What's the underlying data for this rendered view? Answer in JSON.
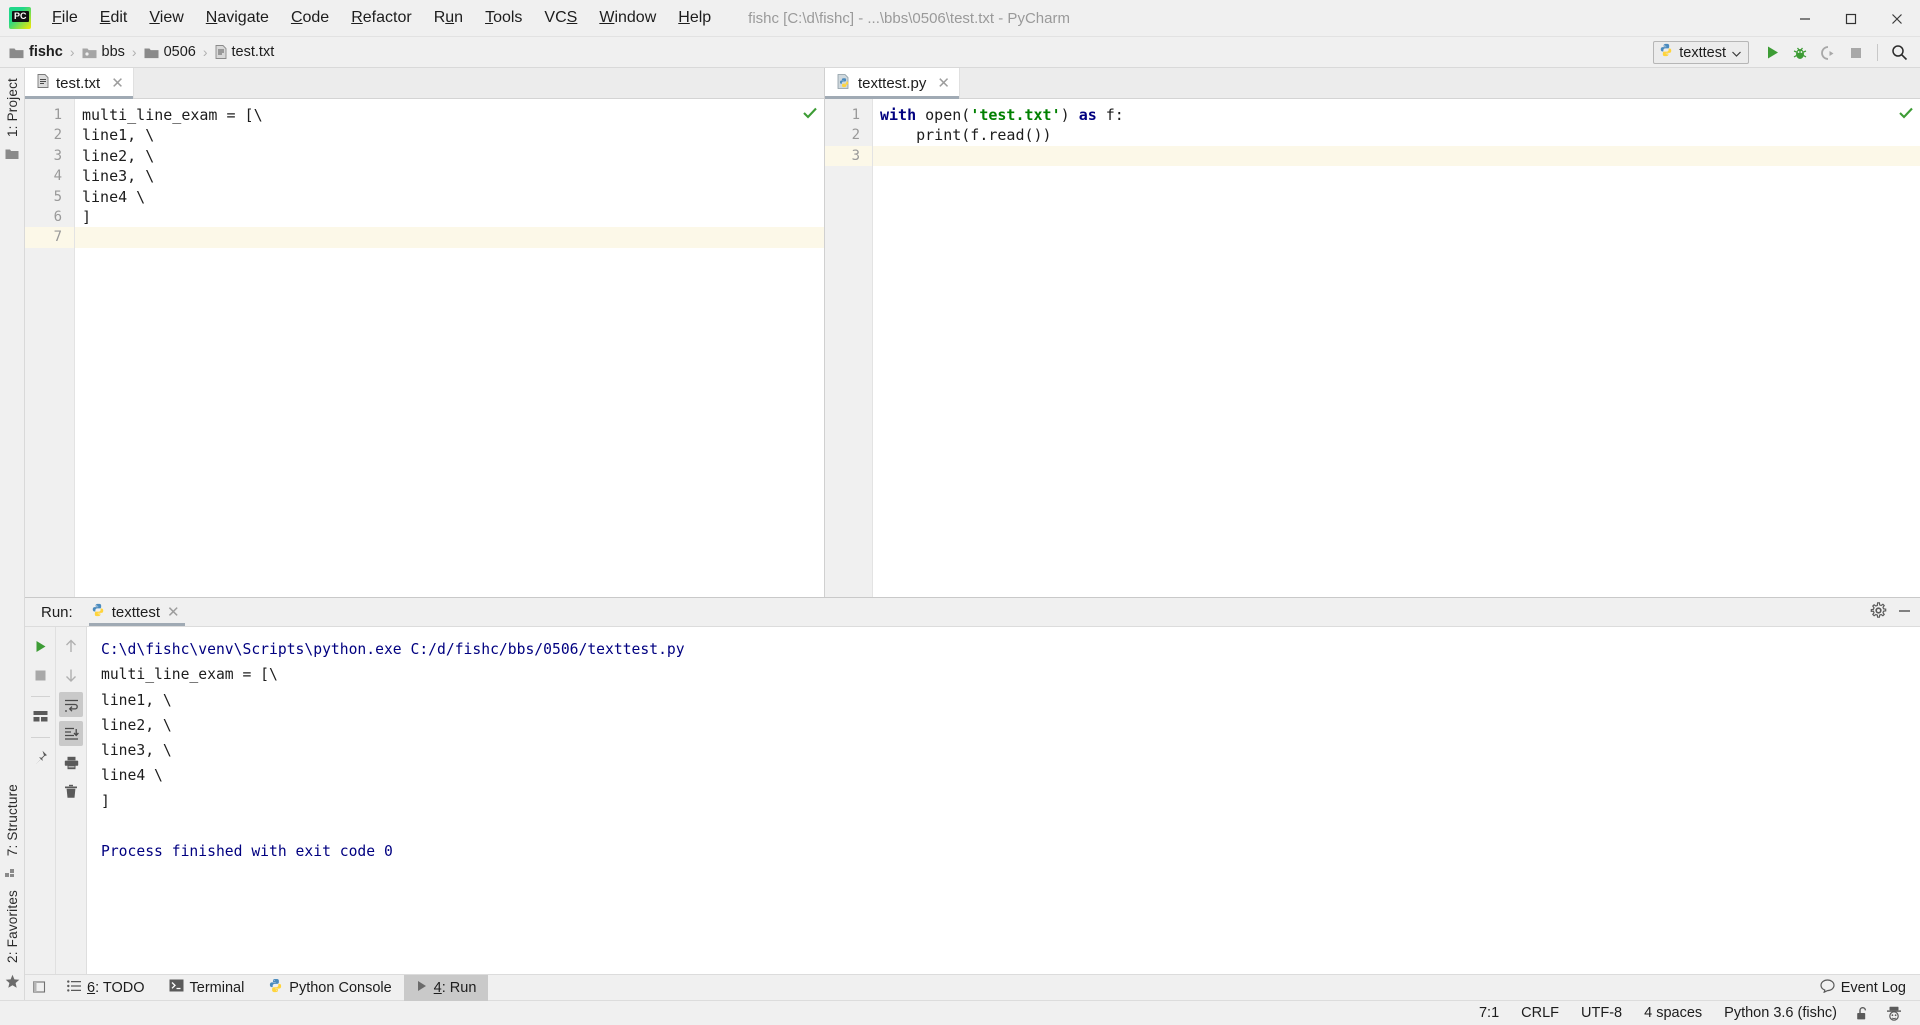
{
  "window": {
    "title": "fishc [C:\\d\\fishc] - ...\\bbs\\0506\\test.txt - PyCharm",
    "minimize": "─",
    "maximize": "❐",
    "close": "✕"
  },
  "menubar": {
    "items": [
      {
        "label": "File",
        "mnemonic": "F"
      },
      {
        "label": "Edit",
        "mnemonic": "E"
      },
      {
        "label": "View",
        "mnemonic": "V"
      },
      {
        "label": "Navigate",
        "mnemonic": "N"
      },
      {
        "label": "Code",
        "mnemonic": "C"
      },
      {
        "label": "Refactor",
        "mnemonic": "R"
      },
      {
        "label": "Run",
        "mnemonic": "u"
      },
      {
        "label": "Tools",
        "mnemonic": "T"
      },
      {
        "label": "VCS",
        "mnemonic": "S"
      },
      {
        "label": "Window",
        "mnemonic": "W"
      },
      {
        "label": "Help",
        "mnemonic": "H"
      }
    ]
  },
  "breadcrumb": {
    "items": [
      {
        "label": "fishc",
        "icon": "folder-icon"
      },
      {
        "label": "bbs",
        "icon": "folder-icon"
      },
      {
        "label": "0506",
        "icon": "folder-icon"
      },
      {
        "label": "test.txt",
        "icon": "text-file-icon"
      }
    ],
    "separator": "›"
  },
  "toolbar": {
    "run_config": "texttest",
    "run_config_icon": "python-icon",
    "dropdown_arrow": "⌄",
    "buttons": [
      {
        "name": "run-button",
        "icon": "play-icon"
      },
      {
        "name": "debug-button",
        "icon": "bug-icon"
      },
      {
        "name": "run-coverage-button",
        "icon": "coverage-icon"
      },
      {
        "name": "stop-button",
        "icon": "stop-icon"
      },
      {
        "name": "search-everywhere-button",
        "icon": "search-icon"
      }
    ]
  },
  "left_stripe": {
    "project_label": "1: Project",
    "structure_label": "7: Structure",
    "favorites_label": "2: Favorites"
  },
  "editor_left": {
    "tab": {
      "label": "test.txt",
      "icon": "text-file-icon",
      "close": "✕"
    },
    "inspection": "✔",
    "lines": [
      {
        "num": "1",
        "text": "multi_line_exam = [\\",
        "current": false
      },
      {
        "num": "2",
        "text": "line1, \\",
        "current": false
      },
      {
        "num": "3",
        "text": "line2, \\",
        "current": false
      },
      {
        "num": "4",
        "text": "line3, \\",
        "current": false
      },
      {
        "num": "5",
        "text": "line4 \\",
        "current": false
      },
      {
        "num": "6",
        "text": "]",
        "current": false
      },
      {
        "num": "7",
        "text": "",
        "current": true
      }
    ]
  },
  "editor_right": {
    "tab": {
      "label": "texttest.py",
      "icon": "python-file-icon",
      "close": "✕"
    },
    "inspection": "✔",
    "lines": [
      {
        "num": "1",
        "current": false,
        "tokens": [
          {
            "t": "with",
            "c": "kw"
          },
          {
            "t": " ",
            "c": ""
          },
          {
            "t": "open",
            "c": "fn"
          },
          {
            "t": "(",
            "c": ""
          },
          {
            "t": "'test.txt'",
            "c": "str"
          },
          {
            "t": ") ",
            "c": ""
          },
          {
            "t": "as",
            "c": "kw"
          },
          {
            "t": " f:",
            "c": ""
          }
        ]
      },
      {
        "num": "2",
        "current": false,
        "tokens": [
          {
            "t": "    print(f.read())",
            "c": ""
          }
        ]
      },
      {
        "num": "3",
        "current": true,
        "tokens": [
          {
            "t": "",
            "c": ""
          }
        ]
      }
    ]
  },
  "run_window": {
    "header_label": "Run:",
    "tab_label": "texttest",
    "tab_icon": "python-icon",
    "tab_close": "✕",
    "settings_icon": "gear-icon",
    "hide_icon": "minimize-icon",
    "left_buttons": [
      {
        "name": "rerun-button",
        "icon": "play-icon",
        "active": false
      },
      {
        "name": "stop-button",
        "icon": "stop-icon",
        "active": false
      },
      {
        "name": "restore-layout-button",
        "icon": "layout-icon",
        "active": false
      },
      {
        "name": "pin-tab-button",
        "icon": "pin-icon",
        "active": false
      }
    ],
    "right_buttons": [
      {
        "name": "up-the-stack-button",
        "icon": "arrow-up-icon",
        "active": false
      },
      {
        "name": "down-the-stack-button",
        "icon": "arrow-down-icon",
        "active": false
      },
      {
        "name": "soft-wrap-button",
        "icon": "wrap-icon",
        "active": true
      },
      {
        "name": "scroll-to-end-button",
        "icon": "scroll-end-icon",
        "active": true
      },
      {
        "name": "print-button",
        "icon": "printer-icon",
        "active": false
      },
      {
        "name": "clear-all-button",
        "icon": "trash-icon",
        "active": false
      }
    ],
    "console": [
      {
        "text": "C:\\d\\fishc\\venv\\Scripts\\python.exe C:/d/fishc/bbs/0506/texttest.py",
        "sys": true
      },
      {
        "text": "multi_line_exam = [\\",
        "sys": false
      },
      {
        "text": "line1, \\",
        "sys": false
      },
      {
        "text": "line2, \\",
        "sys": false
      },
      {
        "text": "line3, \\",
        "sys": false
      },
      {
        "text": "line4 \\",
        "sys": false
      },
      {
        "text": "]",
        "sys": false
      },
      {
        "text": "",
        "sys": false
      },
      {
        "text": "Process finished with exit code 0",
        "sys": true
      }
    ]
  },
  "bottom_bar": {
    "items": [
      {
        "label": "6: TODO",
        "icon": "todo-icon",
        "active": false
      },
      {
        "label": "Terminal",
        "icon": "terminal-icon",
        "active": false
      },
      {
        "label": "Python Console",
        "icon": "python-icon",
        "active": false
      },
      {
        "label": "4: Run",
        "icon": "play-icon",
        "active": true
      }
    ],
    "event_log": {
      "label": "Event Log",
      "icon": "balloon-icon"
    }
  },
  "status_bar": {
    "caret": "7:1",
    "line_separator": "CRLF",
    "encoding": "UTF-8",
    "indent": "4 spaces",
    "interpreter": "Python 3.6 (fishc)",
    "lock_icon": "unlocked-padlock-icon",
    "inspector_icon": "hector-inspector-icon"
  },
  "colors": {
    "accent_green": "#3d9c35",
    "keyword": "#000080",
    "string": "#008000",
    "console_system": "#000080",
    "current_line": "#fcf8e8",
    "tab_underline": "#a0aab4"
  }
}
